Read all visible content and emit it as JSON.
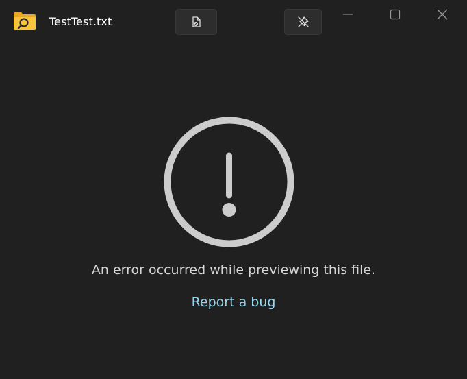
{
  "window": {
    "title": "TestTest.txt",
    "app_icon": "folder-search-icon",
    "colors": {
      "background": "#202020",
      "button_bg": "#2d2d2d",
      "link": "#93d7ef",
      "folder": "#f8c43c"
    }
  },
  "toolbar": {
    "open_with_icon": "open-file-icon",
    "pin_icon": "unpin-icon"
  },
  "caption_buttons": {
    "minimize_icon": "minimize-icon",
    "maximize_icon": "maximize-icon",
    "close_icon": "close-icon"
  },
  "error": {
    "icon": "error-exclamation-icon",
    "message": "An error occurred while previewing this file.",
    "report_link": "Report a bug"
  }
}
